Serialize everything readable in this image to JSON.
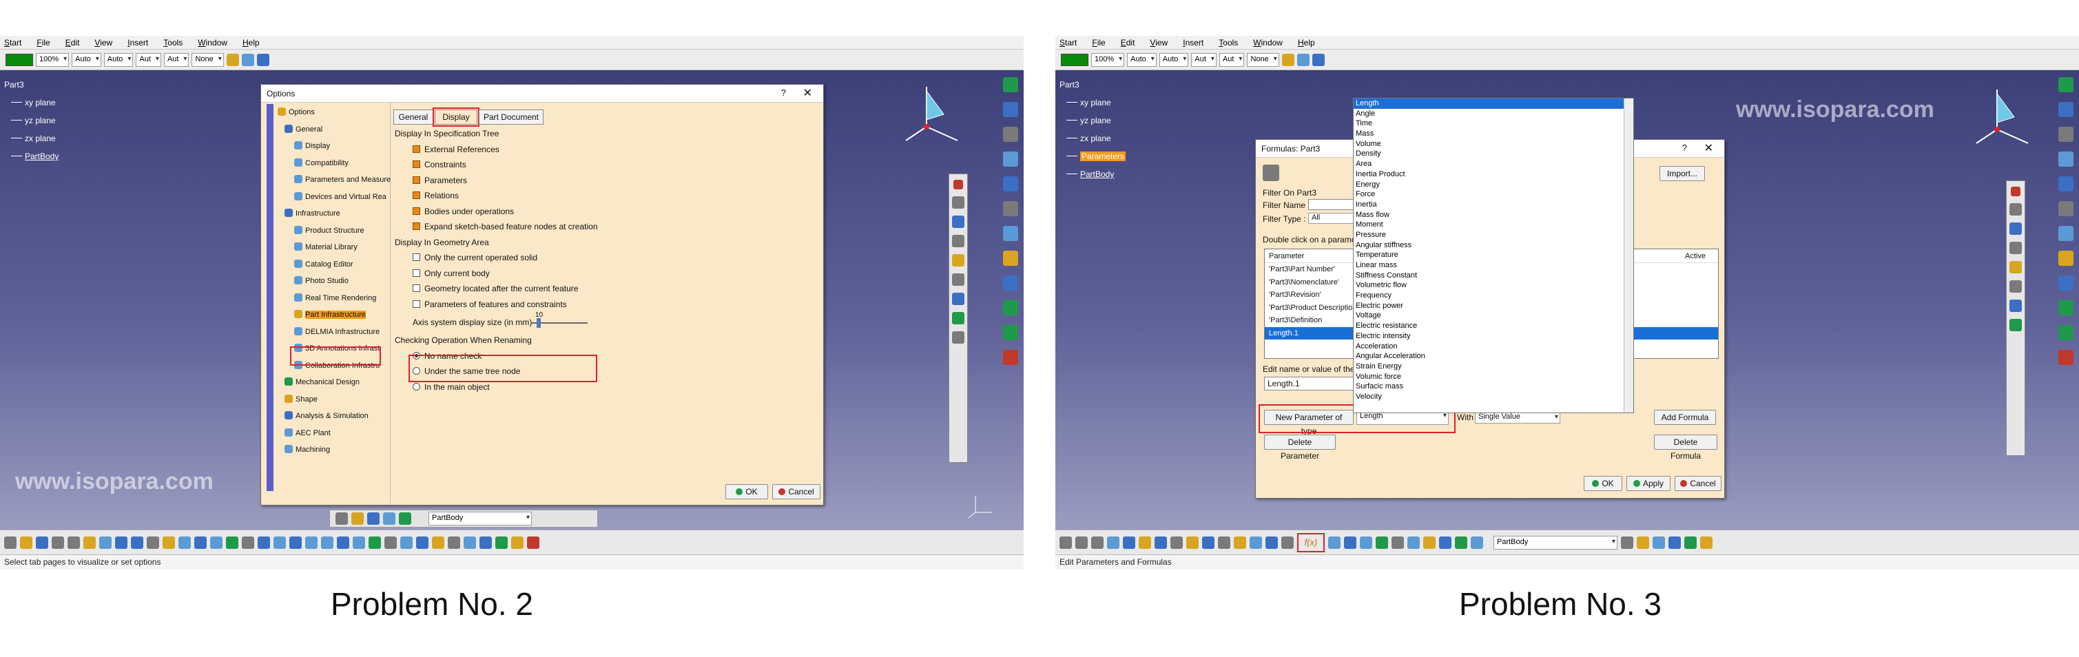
{
  "left": {
    "menu": [
      "Start",
      "File",
      "Edit",
      "View",
      "Insert",
      "Tools",
      "Window",
      "Help"
    ],
    "toolbar_combos": [
      "100%",
      "Auto",
      "Auto",
      "Aut",
      "Aut",
      "None"
    ],
    "tree": {
      "root": "Part3",
      "items": [
        "xy plane",
        "yz plane",
        "zx plane",
        "PartBody"
      ]
    },
    "watermark": "www.isopara.com",
    "status": "Select tab pages to visualize or set options",
    "bottom_combo": "PartBody",
    "dialog": {
      "title": "Options",
      "help": "?",
      "close": "✕",
      "tabs": [
        "General",
        "Display",
        "Part Document"
      ],
      "nav": [
        "Options",
        "General",
        "Display",
        "Compatibility",
        "Parameters and Measure",
        "Devices and Virtual Rea",
        "Infrastructure",
        "Product Structure",
        "Material Library",
        "Catalog Editor",
        "Photo Studio",
        "Real Time Rendering",
        "Part Infrastructure",
        "DELMIA Infrastructure",
        "3D Annotations Infrast",
        "Collaboration Infrastru",
        "Mechanical Design",
        "Shape",
        "Analysis & Simulation",
        "AEC Plant",
        "Machining"
      ],
      "sec1": "Display In Specification Tree",
      "spec_items": [
        "External References",
        "Constraints",
        "Parameters",
        "Relations",
        "Bodies under operations",
        "Expand sketch-based feature nodes at creation"
      ],
      "sec2": "Display In Geometry Area",
      "geo_items": [
        "Only the current operated solid",
        "Only current body",
        "Geometry located after the current feature",
        "Parameters of features and constraints"
      ],
      "axis_label": "Axis system display size (in mm)",
      "axis_value": "10",
      "sec3": "Checking Operation When Renaming",
      "radio_items": [
        "No name check",
        "Under the same tree node",
        "In the main object"
      ],
      "ok": "OK",
      "cancel": "Cancel"
    },
    "caption": "Problem No. 2"
  },
  "right": {
    "menu": [
      "Start",
      "File",
      "Edit",
      "View",
      "Insert",
      "Tools",
      "Window",
      "Help"
    ],
    "toolbar_combos": [
      "100%",
      "Auto",
      "Auto",
      "Aut",
      "Aut",
      "None"
    ],
    "tree": {
      "root": "Part3",
      "items": [
        "xy plane",
        "yz plane",
        "zx plane",
        "Parameters",
        "PartBody"
      ]
    },
    "watermark": "www.isopara.com",
    "status": "Edit Parameters and Formulas",
    "bottom_combo": "PartBody",
    "dialog": {
      "title": "Formulas: Part3",
      "help": "?",
      "close": "✕",
      "import": "Import...",
      "filter_on": "Filter On Part3",
      "filter_name": "Filter Name :",
      "filter_type": "Filter Type :",
      "filter_type_value": "All",
      "double_click": "Double click on a parameter",
      "col_parameter": "Parameter",
      "col_active": "Active",
      "params": [
        "'Part3\\Part Number'",
        "'Part3\\Nomenclature'",
        "'Part3\\Revision'",
        "'Part3\\Product Descriptio",
        "'Part3\\Definition",
        "Length.1"
      ],
      "edit_label": "Edit name or value of the c",
      "edit_value": "Length.1",
      "new_param": "New Parameter of type",
      "new_param_type": "Length",
      "with": "With",
      "with_value": "Single Value",
      "add_formula": "Add Formula",
      "delete_param": "Delete Parameter",
      "delete_formula": "Delete Formula",
      "ok": "OK",
      "apply": "Apply",
      "cancel": "Cancel",
      "type_list": [
        "Length",
        "Angle",
        "Time",
        "Mass",
        "Volume",
        "Density",
        "Area",
        "Inertia Product",
        "Energy",
        "Force",
        "Inertia",
        "Mass flow",
        "Moment",
        "Pressure",
        "Angular stiffness",
        "Temperature",
        "Linear mass",
        "Stiffness Constant",
        "Volumetric flow",
        "Frequency",
        "Electric power",
        "Voltage",
        "Electric resistance",
        "Electric intensity",
        "Acceleration",
        "Angular Acceleration",
        "Strain Energy",
        "Volumic force",
        "Surfacic mass",
        "Velocity"
      ]
    },
    "caption": "Problem No. 3"
  },
  "colors": {
    "accent_red": "#e0202a",
    "dialog_bg": "#fbe8c8",
    "viewport_top": "#3d3f78",
    "selection": "#1a6fd6",
    "highlight": "#f29a1f"
  }
}
